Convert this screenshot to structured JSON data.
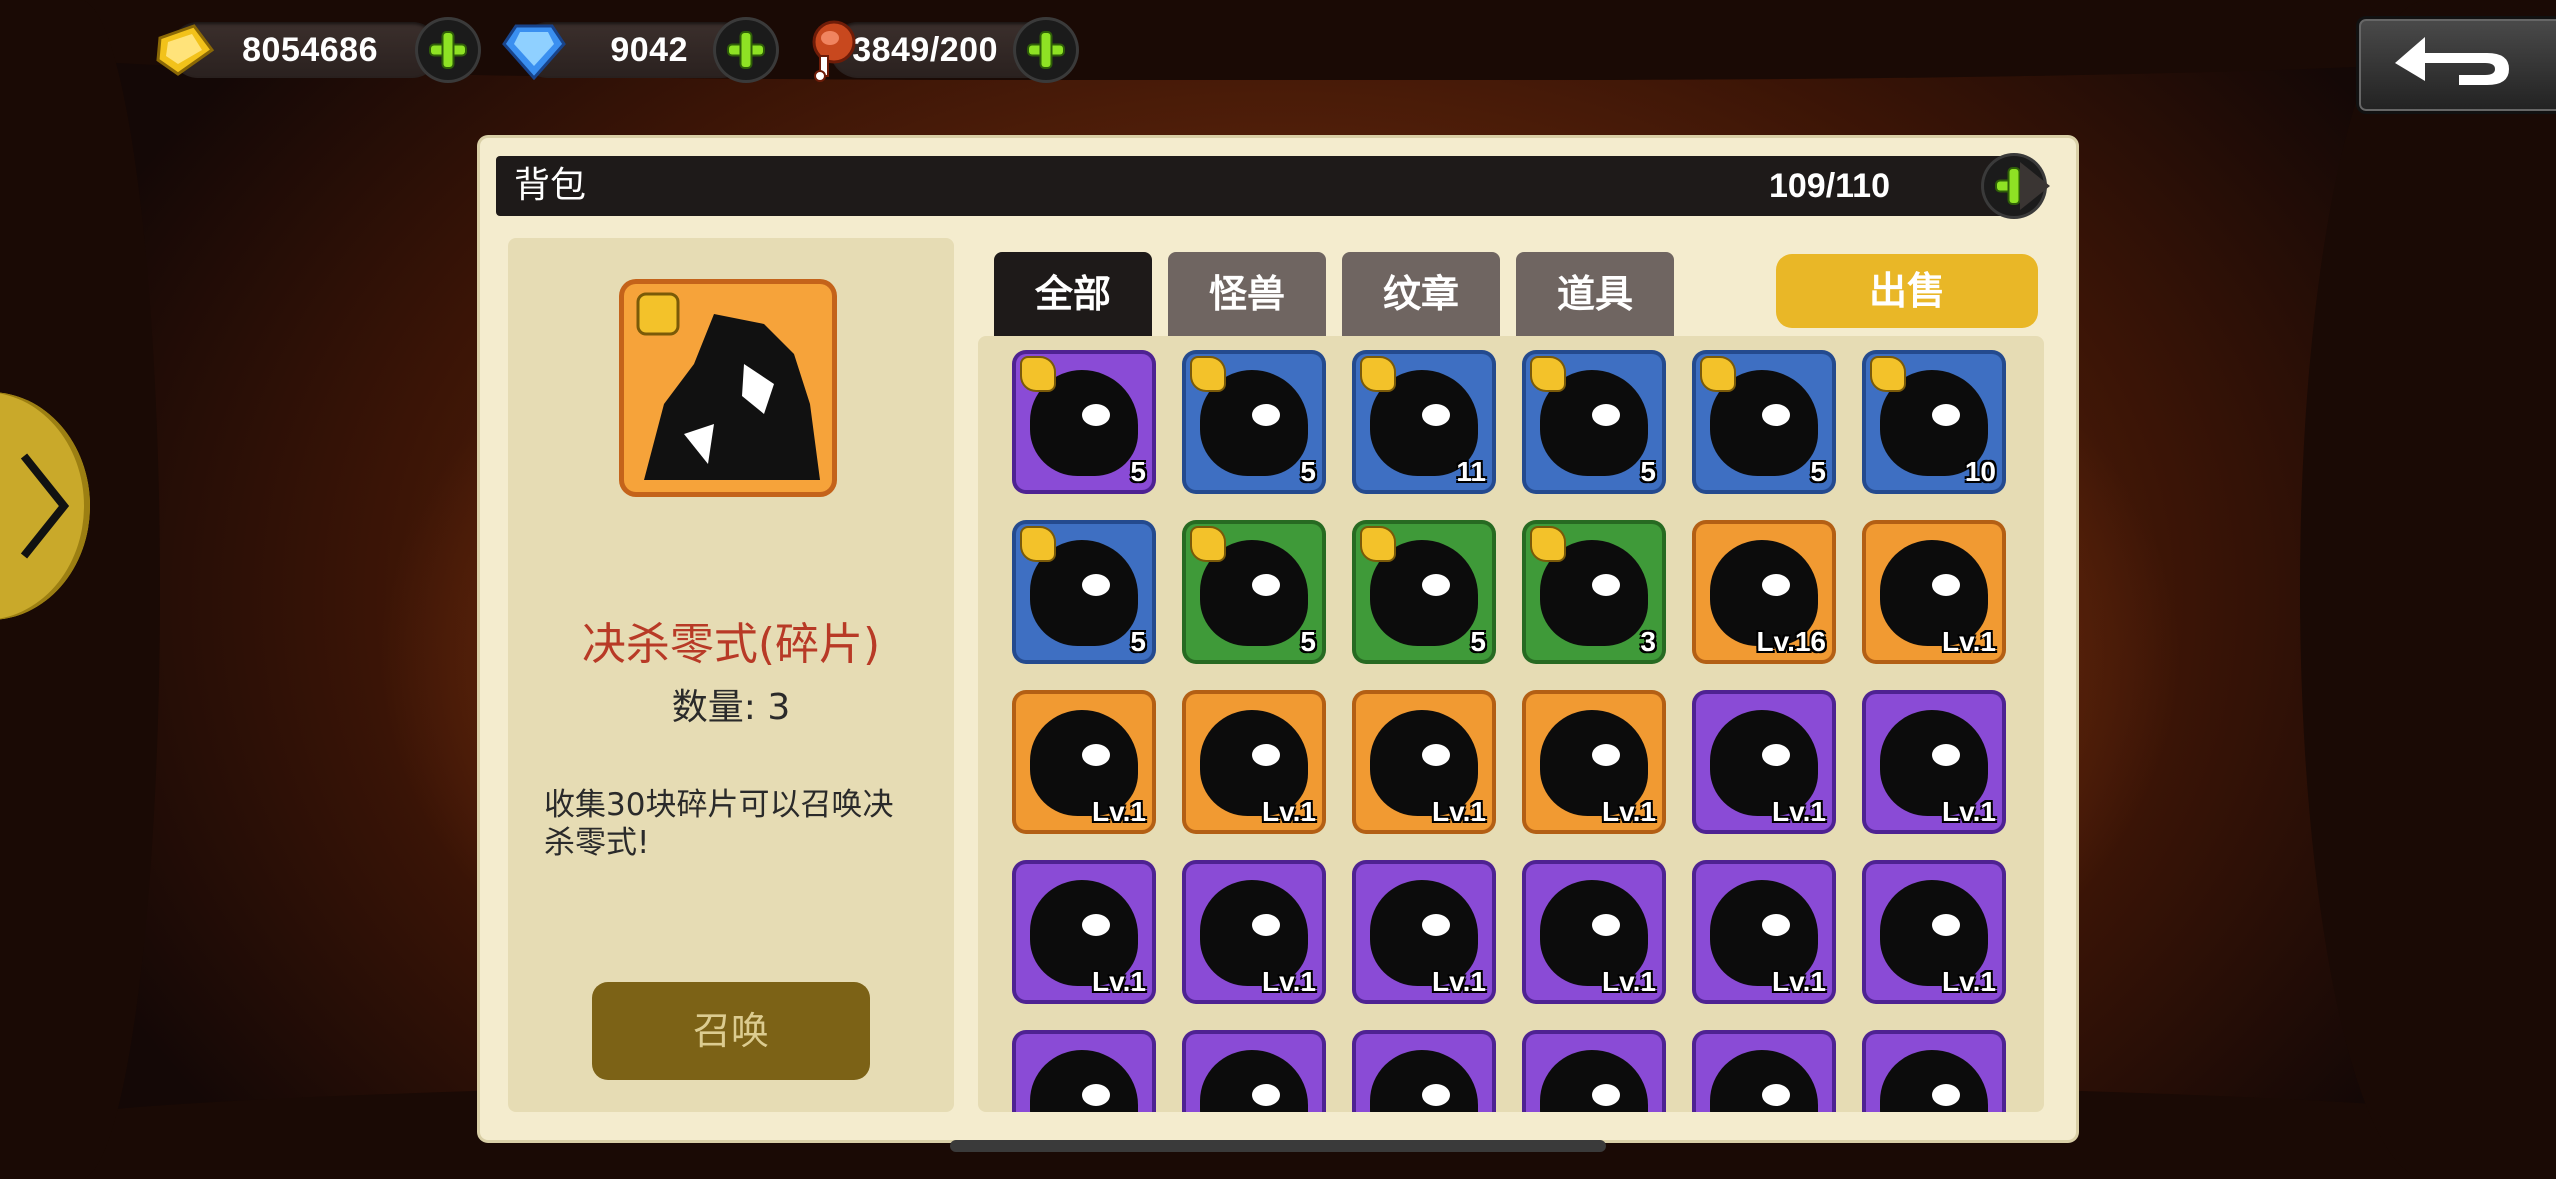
{
  "top_bar": {
    "gold": {
      "value": "8054686",
      "icon": "gold-icon"
    },
    "gems": {
      "value": "9042",
      "icon": "gem-icon"
    },
    "food": {
      "value": "3849/200",
      "icon": "meat-icon"
    }
  },
  "panel": {
    "title": "背包",
    "capacity": "109/110"
  },
  "detail": {
    "name": "决杀零式(碎片)",
    "quantity": "数量: 3",
    "description": "收集30块碎片可以召唤决杀零式!",
    "summon_label": "召唤"
  },
  "tabs": [
    "全部",
    "怪兽",
    "纹章",
    "道具"
  ],
  "sell_label": "出售",
  "items": [
    {
      "rarity": "purple",
      "fragment": true,
      "label": "5"
    },
    {
      "rarity": "blue",
      "fragment": true,
      "label": "5"
    },
    {
      "rarity": "blue",
      "fragment": true,
      "label": "11"
    },
    {
      "rarity": "blue",
      "fragment": true,
      "label": "5"
    },
    {
      "rarity": "blue",
      "fragment": true,
      "label": "5"
    },
    {
      "rarity": "blue",
      "fragment": true,
      "label": "10"
    },
    {
      "rarity": "blue",
      "fragment": true,
      "label": "5"
    },
    {
      "rarity": "green",
      "fragment": true,
      "label": "5"
    },
    {
      "rarity": "green",
      "fragment": true,
      "label": "5"
    },
    {
      "rarity": "green",
      "fragment": true,
      "label": "3"
    },
    {
      "rarity": "orange",
      "fragment": false,
      "label": "Lv.16"
    },
    {
      "rarity": "orange",
      "fragment": false,
      "label": "Lv.1"
    },
    {
      "rarity": "orange",
      "fragment": false,
      "label": "Lv.1"
    },
    {
      "rarity": "orange",
      "fragment": false,
      "label": "Lv.1"
    },
    {
      "rarity": "orange",
      "fragment": false,
      "label": "Lv.1"
    },
    {
      "rarity": "orange",
      "fragment": false,
      "label": "Lv.1"
    },
    {
      "rarity": "purple",
      "fragment": false,
      "label": "Lv.1"
    },
    {
      "rarity": "purple",
      "fragment": false,
      "label": "Lv.1"
    },
    {
      "rarity": "purple",
      "fragment": false,
      "label": "Lv.1"
    },
    {
      "rarity": "purple",
      "fragment": false,
      "label": "Lv.1"
    },
    {
      "rarity": "purple",
      "fragment": false,
      "label": "Lv.1"
    },
    {
      "rarity": "purple",
      "fragment": false,
      "label": "Lv.1"
    },
    {
      "rarity": "purple",
      "fragment": false,
      "label": "Lv.1"
    },
    {
      "rarity": "purple",
      "fragment": false,
      "label": "Lv.1"
    },
    {
      "rarity": "purple",
      "fragment": false,
      "label": ""
    },
    {
      "rarity": "purple",
      "fragment": false,
      "label": ""
    },
    {
      "rarity": "purple",
      "fragment": false,
      "label": ""
    },
    {
      "rarity": "purple",
      "fragment": false,
      "label": ""
    },
    {
      "rarity": "purple",
      "fragment": false,
      "label": ""
    },
    {
      "rarity": "purple",
      "fragment": false,
      "label": ""
    }
  ],
  "colors": {
    "purple": "#8a4bd6",
    "blue": "#3e6fc2",
    "green": "#3f9a39",
    "orange": "#f19a32",
    "sell": "#e9b727",
    "summon": "#7c6216",
    "name": "#b83a26"
  }
}
